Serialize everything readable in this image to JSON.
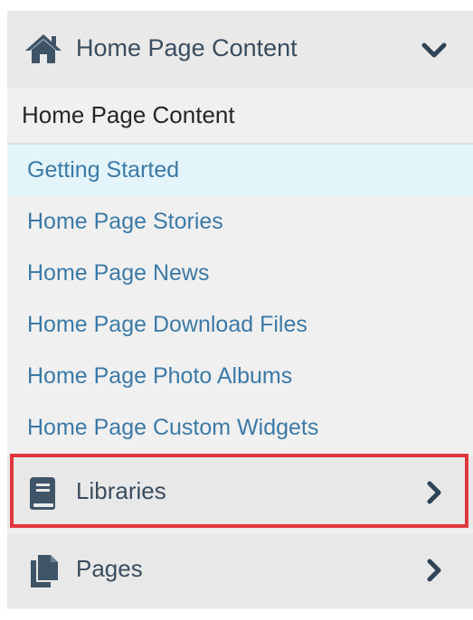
{
  "header": {
    "title": "Home Page Content",
    "icon": "home-icon",
    "toggle_icon": "chevron-down-icon"
  },
  "subtitle": "Home Page Content",
  "nav": {
    "items": [
      {
        "label": "Getting Started",
        "active": true
      },
      {
        "label": "Home Page Stories",
        "active": false
      },
      {
        "label": "Home Page News",
        "active": false
      },
      {
        "label": "Home Page Download Files",
        "active": false
      },
      {
        "label": "Home Page Photo Albums",
        "active": false
      },
      {
        "label": "Home Page Custom Widgets",
        "active": false
      }
    ]
  },
  "sections": {
    "libraries": {
      "label": "Libraries",
      "icon": "book-icon",
      "chevron": "chevron-right-icon"
    },
    "pages": {
      "label": "Pages",
      "icon": "copy-pages-icon",
      "chevron": "chevron-right-icon"
    }
  },
  "colors": {
    "accent_link": "#3c7aa6",
    "header_text": "#3a4d5f",
    "active_bg": "#e3f4fb",
    "highlight_border": "#e0363d"
  }
}
